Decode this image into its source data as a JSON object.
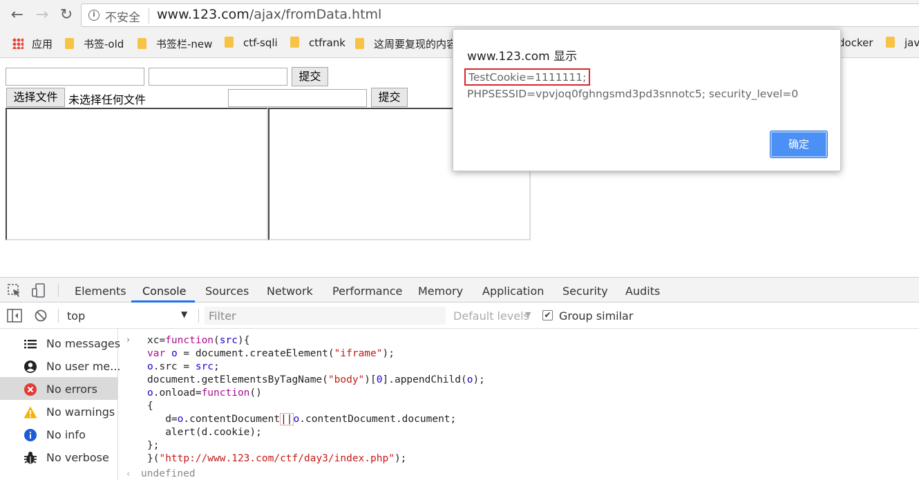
{
  "browser": {
    "security_label": "不安全",
    "url_host": "www.123.com",
    "url_path": "/ajax/fromData.html"
  },
  "bookmarks": [
    {
      "label": "应用",
      "icon": "apps-icon"
    },
    {
      "label": "书签-old",
      "icon": "folder-icon"
    },
    {
      "label": "书签栏-new",
      "icon": "folder-icon"
    },
    {
      "label": "ctf-sqli",
      "icon": "folder-icon"
    },
    {
      "label": "ctfrank",
      "icon": "folder-icon"
    },
    {
      "label": "这周要复现的内容",
      "icon": "folder-icon"
    },
    {
      "label": "docker",
      "icon": "folder-icon"
    },
    {
      "label": "jav",
      "icon": "folder-icon"
    }
  ],
  "page": {
    "submit1": "提交",
    "choose_file": "选择文件",
    "no_file": "未选择任何文件",
    "submit2": "提交"
  },
  "dialog": {
    "title": "www.123.com 显示",
    "line1": "TestCookie=1111111;",
    "line2": "PHPSESSID=vpvjoq0fghngsmd3pd3snnotc5; security_level=0",
    "ok": "确定"
  },
  "devtools": {
    "tabs": [
      "Elements",
      "Console",
      "Sources",
      "Network",
      "Performance",
      "Memory",
      "Application",
      "Security",
      "Audits"
    ],
    "active_tab": "Console",
    "context": "top",
    "filter_placeholder": "Filter",
    "levels": "Default levels",
    "group_similar": "Group similar",
    "sidebar": [
      "No messages",
      "No user me...",
      "No errors",
      "No warnings",
      "No info",
      "No verbose"
    ],
    "result": "undefined",
    "colors": {
      "accent": "#1a73e8",
      "error": "#e53935",
      "warning": "#f4b400",
      "info": "#1e5bd6"
    }
  }
}
